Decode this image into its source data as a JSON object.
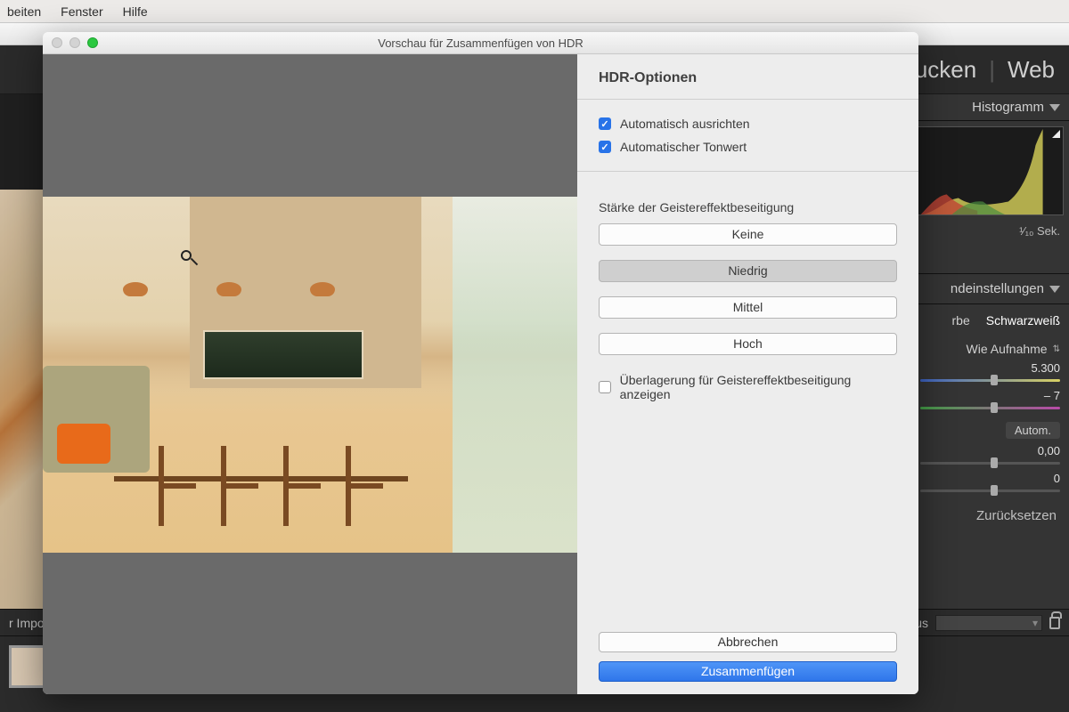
{
  "menubar": {
    "items": [
      "beiten",
      "Fenster",
      "Hilfe"
    ]
  },
  "editor": {
    "modules": {
      "print": "Drucken",
      "web": "Web"
    },
    "panels": {
      "histogram_label": "Histogramm",
      "meta": {
        "exposure": "¹⁄₁₀ Sek."
      },
      "basic_label": "ndeinstellungen",
      "tabs": {
        "color": "rbe",
        "bw": "Schwarzweiß"
      },
      "wb_label": "Wie Aufnahme",
      "temp_value": "5.300",
      "tint_value": "– 7",
      "auto_label": "Autom.",
      "exposure_value": "0,00",
      "contrast_value": "0",
      "reset_label": "Zurücksetzen"
    }
  },
  "filmstrip": {
    "filter_left": "r Impo",
    "filter_right": "er aus"
  },
  "dialog": {
    "title": "Vorschau für Zusammenfügen von HDR",
    "heading": "HDR-Optionen",
    "auto_align": "Automatisch ausrichten",
    "auto_tone": "Automatischer Tonwert",
    "deghost_label": "Stärke der Geistereffektbeseitigung",
    "levels": {
      "none": "Keine",
      "low": "Niedrig",
      "medium": "Mittel",
      "high": "Hoch"
    },
    "overlay": "Überlagerung für Geistereffektbeseitigung anzeigen",
    "cancel": "Abbrechen",
    "merge": "Zusammenfügen"
  }
}
